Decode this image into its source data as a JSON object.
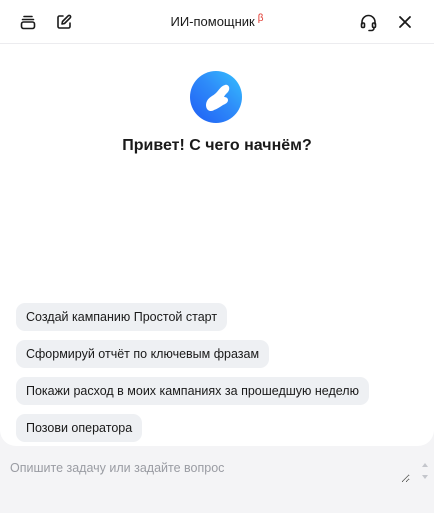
{
  "header": {
    "title": "ИИ-помощник",
    "beta_mark": "β",
    "left_icons": [
      "history-icon",
      "new-chat-icon"
    ],
    "right_icons": [
      "headset-icon",
      "close-icon"
    ]
  },
  "main": {
    "logo": "assistant-logo",
    "greeting": "Привет! С чего начнём?"
  },
  "suggestions": [
    {
      "label": "Создай кампанию Простой старт"
    },
    {
      "label": "Сформируй отчёт по ключевым фразам"
    },
    {
      "label": "Покажи расход в моих кампаниях за прошедшую неделю"
    },
    {
      "label": "Позови оператора"
    }
  ],
  "composer": {
    "placeholder": "Опишите задачу или задайте вопрос",
    "value": ""
  },
  "colors": {
    "accent_gradient": [
      "#1f5df5",
      "#35c2ff"
    ],
    "beta": "#e0352b",
    "chip_bg": "#eef0f3"
  }
}
